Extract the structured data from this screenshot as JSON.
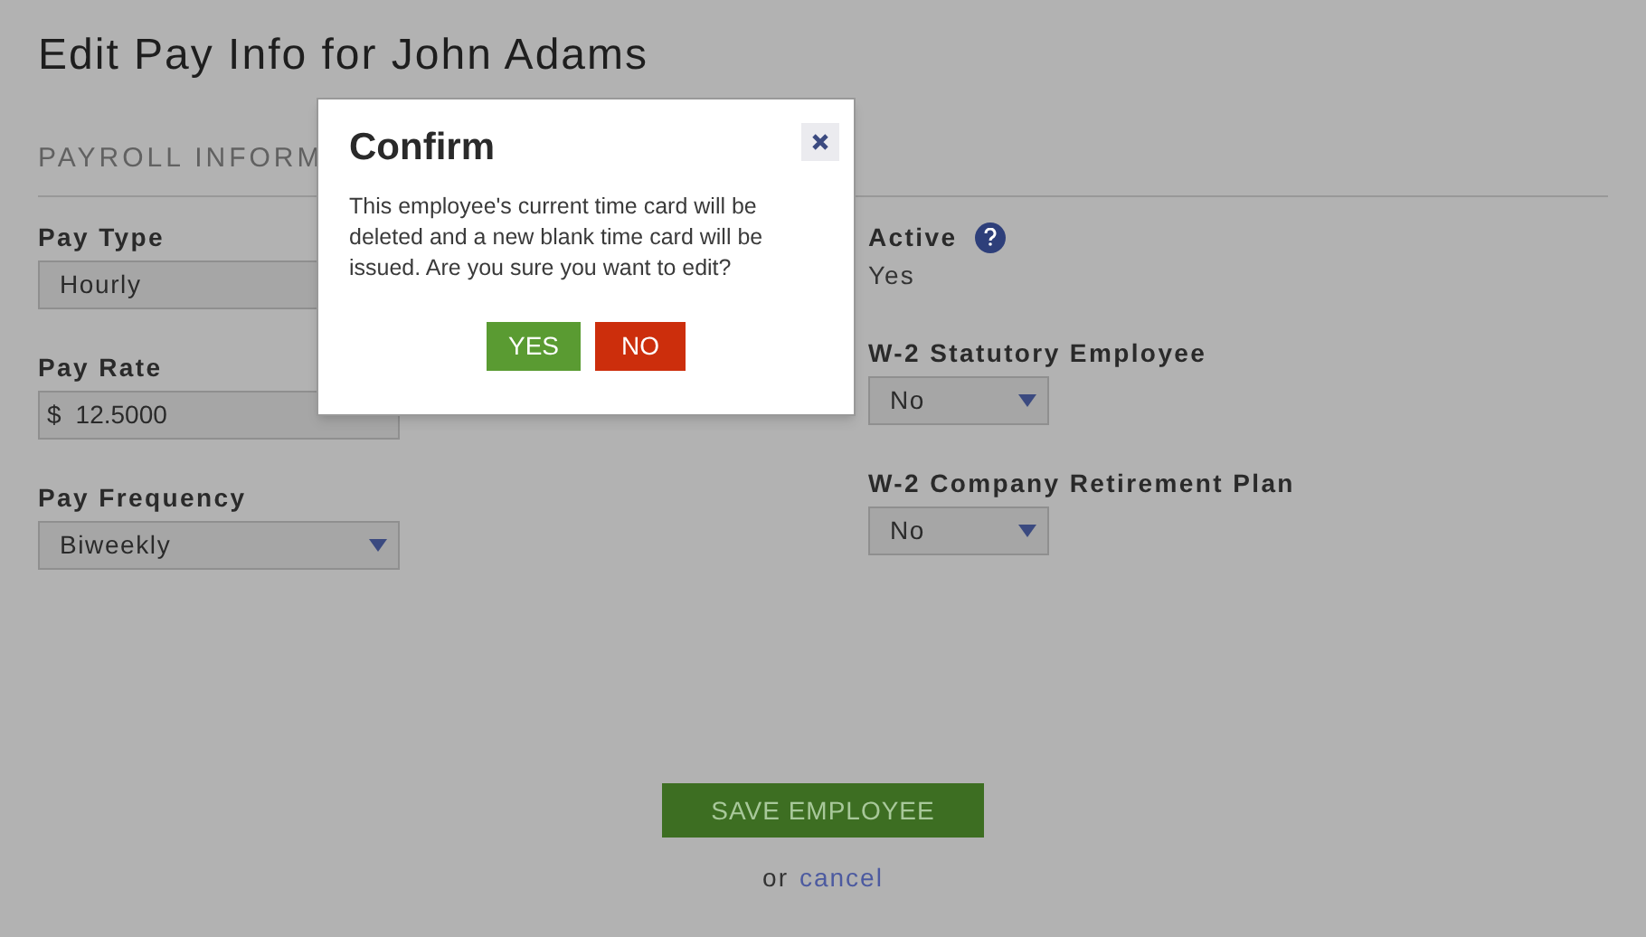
{
  "page": {
    "title": "Edit Pay Info for John Adams"
  },
  "section": {
    "heading": "PAYROLL INFORM"
  },
  "left_fields": [
    {
      "kind": "select",
      "label": "Pay Type",
      "value": "Hourly"
    },
    {
      "kind": "currency",
      "label": "Pay Rate",
      "prefix": "$",
      "value": "12.5000"
    },
    {
      "kind": "select",
      "label": "Pay Frequency",
      "value": "Biweekly"
    }
  ],
  "right_fields": [
    {
      "kind": "readonly",
      "label": "Active",
      "help_icon": true,
      "value": "Yes"
    },
    {
      "kind": "select",
      "label": "W-2 Statutory Employee",
      "value": "No"
    },
    {
      "kind": "select",
      "label": "W-2 Company Retirement Plan",
      "value": "No"
    }
  ],
  "save_button": "SAVE EMPLOYEE",
  "cancel": {
    "prefix": "or",
    "link": "cancel"
  },
  "dialog": {
    "title": "Confirm",
    "message": "This employee's current time card will be deleted and a new blank time card will be issued. Are you sure you want to edit?",
    "buttons": [
      {
        "kind": "confirm",
        "label": "YES"
      },
      {
        "kind": "cancel",
        "label": "NO"
      }
    ]
  }
}
